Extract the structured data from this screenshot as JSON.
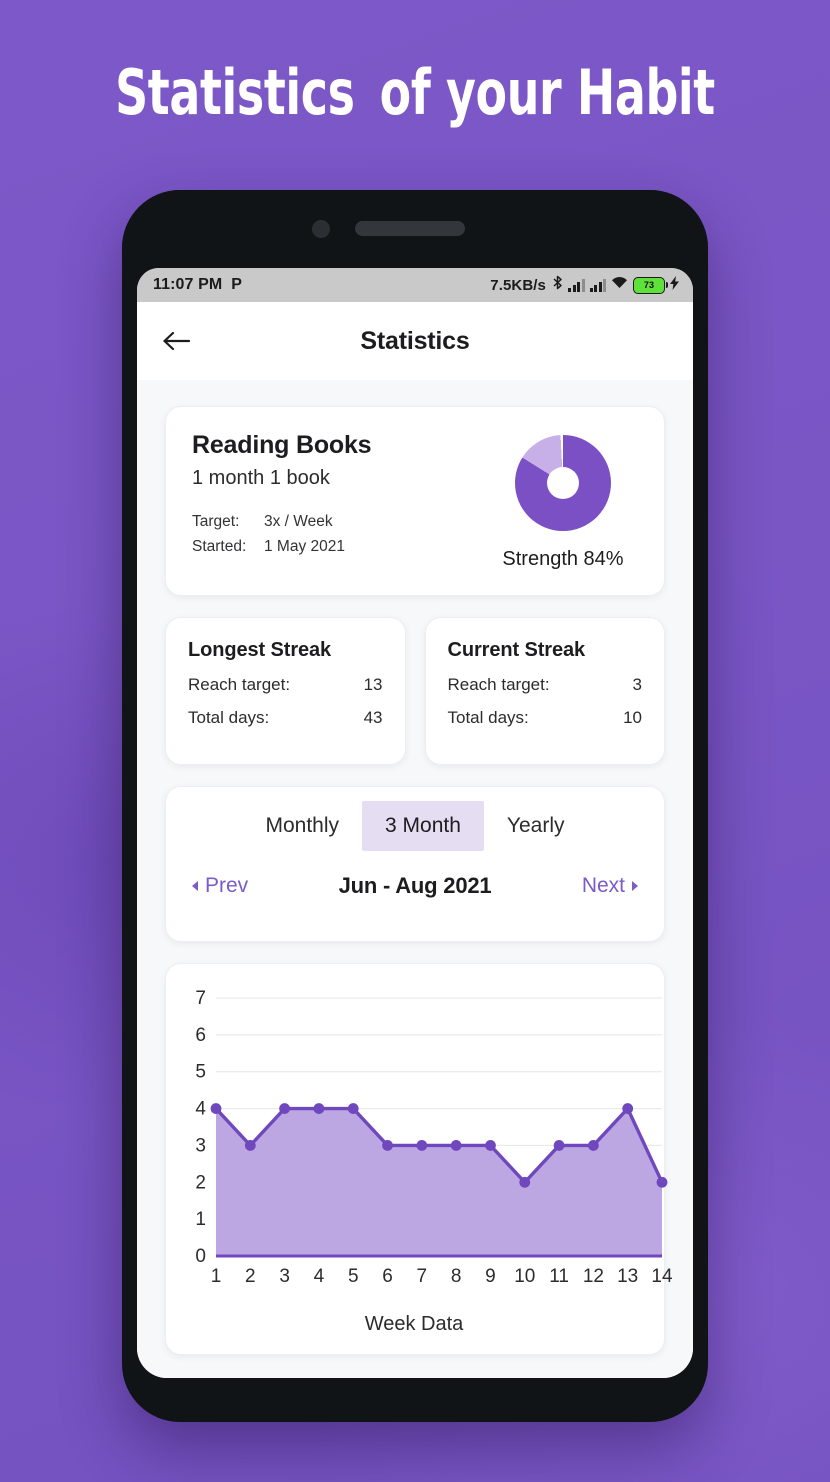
{
  "poster": {
    "headline_part1": "Statistics",
    "headline_part2": "of your Habit",
    "bg_color": "#7b57c6"
  },
  "statusbar": {
    "time": "11:07 PM",
    "app_icon": "P",
    "network_speed": "7.5KB/s",
    "bluetooth_icon": "bluetooth",
    "signal1_icon": "signal-bars",
    "signal2_icon": "signal-bars",
    "wifi_icon": "wifi",
    "battery_level": "73",
    "battery_color": "#5ee23a",
    "charging_icon": "lightning-bolt"
  },
  "appbar": {
    "back_icon": "arrow-left",
    "title": "Statistics"
  },
  "habit": {
    "name": "Reading Books",
    "subtitle": "1 month 1 book",
    "target_label": "Target:",
    "target_value": "3x / Week",
    "started_label": "Started:",
    "started_value": "1 May 2021",
    "strength_text": "Strength 84%",
    "strength_percent": 84,
    "donut_fill_color": "#7b50c4",
    "donut_track_color": "#c7b0e8"
  },
  "streaks": [
    {
      "title": "Longest Streak",
      "reach_label": "Reach target:",
      "reach_value": "13",
      "total_label": "Total days:",
      "total_value": "43"
    },
    {
      "title": "Current Streak",
      "reach_label": "Reach target:",
      "reach_value": "3",
      "total_label": "Total days:",
      "total_value": "10"
    }
  ],
  "period": {
    "segments": [
      {
        "label": "Monthly",
        "active": false
      },
      {
        "label": "3 Month",
        "active": true
      },
      {
        "label": "Yearly",
        "active": false
      }
    ],
    "prev_label": "Prev",
    "next_label": "Next",
    "range_label": "Jun - Aug 2021",
    "active_bg": "#e5ddf1",
    "link_color": "#7b5bc8"
  },
  "chart_data": {
    "type": "area",
    "title": "",
    "xlabel": "Week Data",
    "ylabel": "",
    "categories": [
      "1",
      "2",
      "3",
      "4",
      "5",
      "6",
      "7",
      "8",
      "9",
      "10",
      "11",
      "12",
      "13",
      "14"
    ],
    "values": [
      4,
      3,
      4,
      4,
      4,
      3,
      3,
      3,
      3,
      2,
      3,
      3,
      4,
      2
    ],
    "yticks": [
      0,
      1,
      2,
      3,
      4,
      5,
      6,
      7
    ],
    "ylim": [
      0,
      7
    ],
    "xlim": [
      1,
      14
    ],
    "grid": true,
    "legend": "none",
    "line_color": "#7048be",
    "fill_color": "#bca7e3",
    "point_color": "#7048be"
  }
}
